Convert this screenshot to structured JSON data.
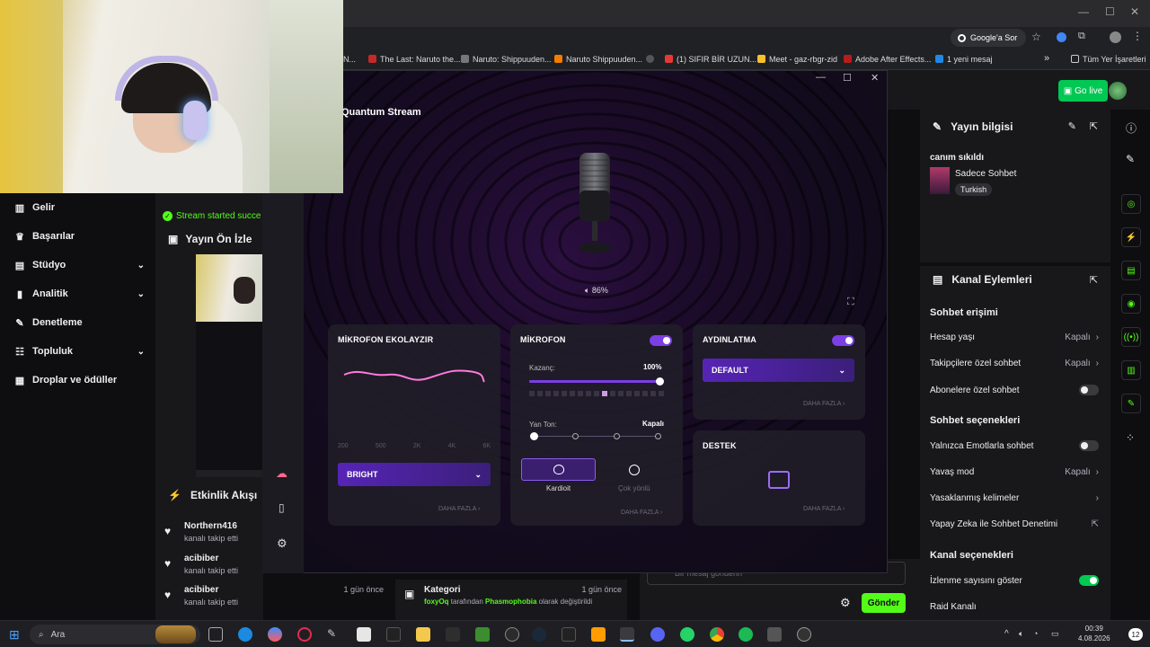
{
  "browser": {
    "ask_google": "Google'a Sor",
    "bookmarks": [
      "N...",
      "The Last: Naruto the...",
      "Naruto: Shippuuden...",
      "Naruto Shippuuden...",
      "(1) SIFIR BİR UZUN...",
      "Meet - gaz-rbgr-zid",
      "Adobe After Effects...",
      "1 yeni mesaj"
    ],
    "all_bookmarks": "Tüm Yer İşaretleri"
  },
  "twitch": {
    "go_live": "Go live",
    "left_nav": [
      {
        "label": "Gelir",
        "icon": "bar-chart-icon",
        "chevron": false
      },
      {
        "label": "Başarılar",
        "icon": "trophy-icon",
        "chevron": false
      },
      {
        "label": "Stüdyo",
        "icon": "studio-icon",
        "chevron": true
      },
      {
        "label": "Analitik",
        "icon": "analytics-icon",
        "chevron": true
      },
      {
        "label": "Denetleme",
        "icon": "wrench-icon",
        "chevron": false
      },
      {
        "label": "Topluluk",
        "icon": "community-icon",
        "chevron": true
      },
      {
        "label": "Droplar ve ödüller",
        "icon": "drops-icon",
        "chevron": false
      }
    ],
    "stream_started": "Stream started succe",
    "preview_title": "Yayın Ön İzle",
    "activity_title": "Etkinlik Akışı",
    "activity": [
      {
        "name": "Northern416",
        "action": "kanalı takip etti",
        "when": ""
      },
      {
        "name": "acibiber",
        "action": "kanalı takip etti",
        "when": ""
      },
      {
        "name": "acibiber",
        "action": "kanalı takip etti",
        "when": "1 gün önce"
      }
    ],
    "category": {
      "title": "Kategori",
      "when": "1 gün önce",
      "user": "foxyOq",
      "text1": " tarafından ",
      "game": "Phasmophobia",
      "text2": " olarak değiştirildi"
    },
    "chat": {
      "placeholder": "Bir mesaj gönderin",
      "send": "Gönder"
    },
    "info": {
      "title": "Yayın bilgisi",
      "stream_title": "canım sıkıldı",
      "category": "Sadece Sohbet",
      "tag": "Turkish"
    },
    "actions": {
      "title": "Kanal Eylemleri",
      "chat_access": "Sohbet erişimi",
      "account_age": "Hesap yaşı",
      "account_age_value": "Kapalı",
      "followers_only": "Takipçilere özel sohbet",
      "followers_only_value": "Kapalı",
      "subs_only": "Abonelere özel sohbet",
      "chat_options": "Sohbet seçenekleri",
      "emote_only": "Yalnızca Emotlarla sohbet",
      "slow_mode": "Yavaş mod",
      "slow_mode_value": "Kapalı",
      "banned_words": "Yasaklanmış kelimeler",
      "ai_moderation": "Yapay Zeka ile Sohbet Denetimi",
      "channel_options": "Kanal seçenekleri",
      "show_viewcount": "İzlenme sayısını göster",
      "raid": "Raid Kanalı"
    }
  },
  "app": {
    "title": "Quantum Stream",
    "volume": "86%",
    "equalizer": {
      "title": "MİKROFON EKOLAYZIR",
      "freq_labels": [
        "200",
        "500",
        "2K",
        "4K",
        "6K"
      ],
      "preset": "BRIGHT",
      "more": "DAHA FAZLA"
    },
    "mic": {
      "title": "MİKROFON",
      "gain_label": "Kazanç:",
      "gain_value": "100%",
      "gain": 1.0,
      "sidetone_label": "Yan Ton:",
      "sidetone_value": "Kapalı",
      "pattern_cardioid": "Kardioit",
      "pattern_omni": "Çok yönlü",
      "more": "DAHA FAZLA"
    },
    "lighting": {
      "title": "AYDINLATMA",
      "preset": "DEFAULT",
      "more": "DAHA FAZLA"
    },
    "support": {
      "title": "DESTEK",
      "more": "DAHA FAZLA"
    }
  },
  "taskbar": {
    "search": "Ara",
    "time": "00:39",
    "date": "4.08.2026",
    "notif": "12"
  }
}
